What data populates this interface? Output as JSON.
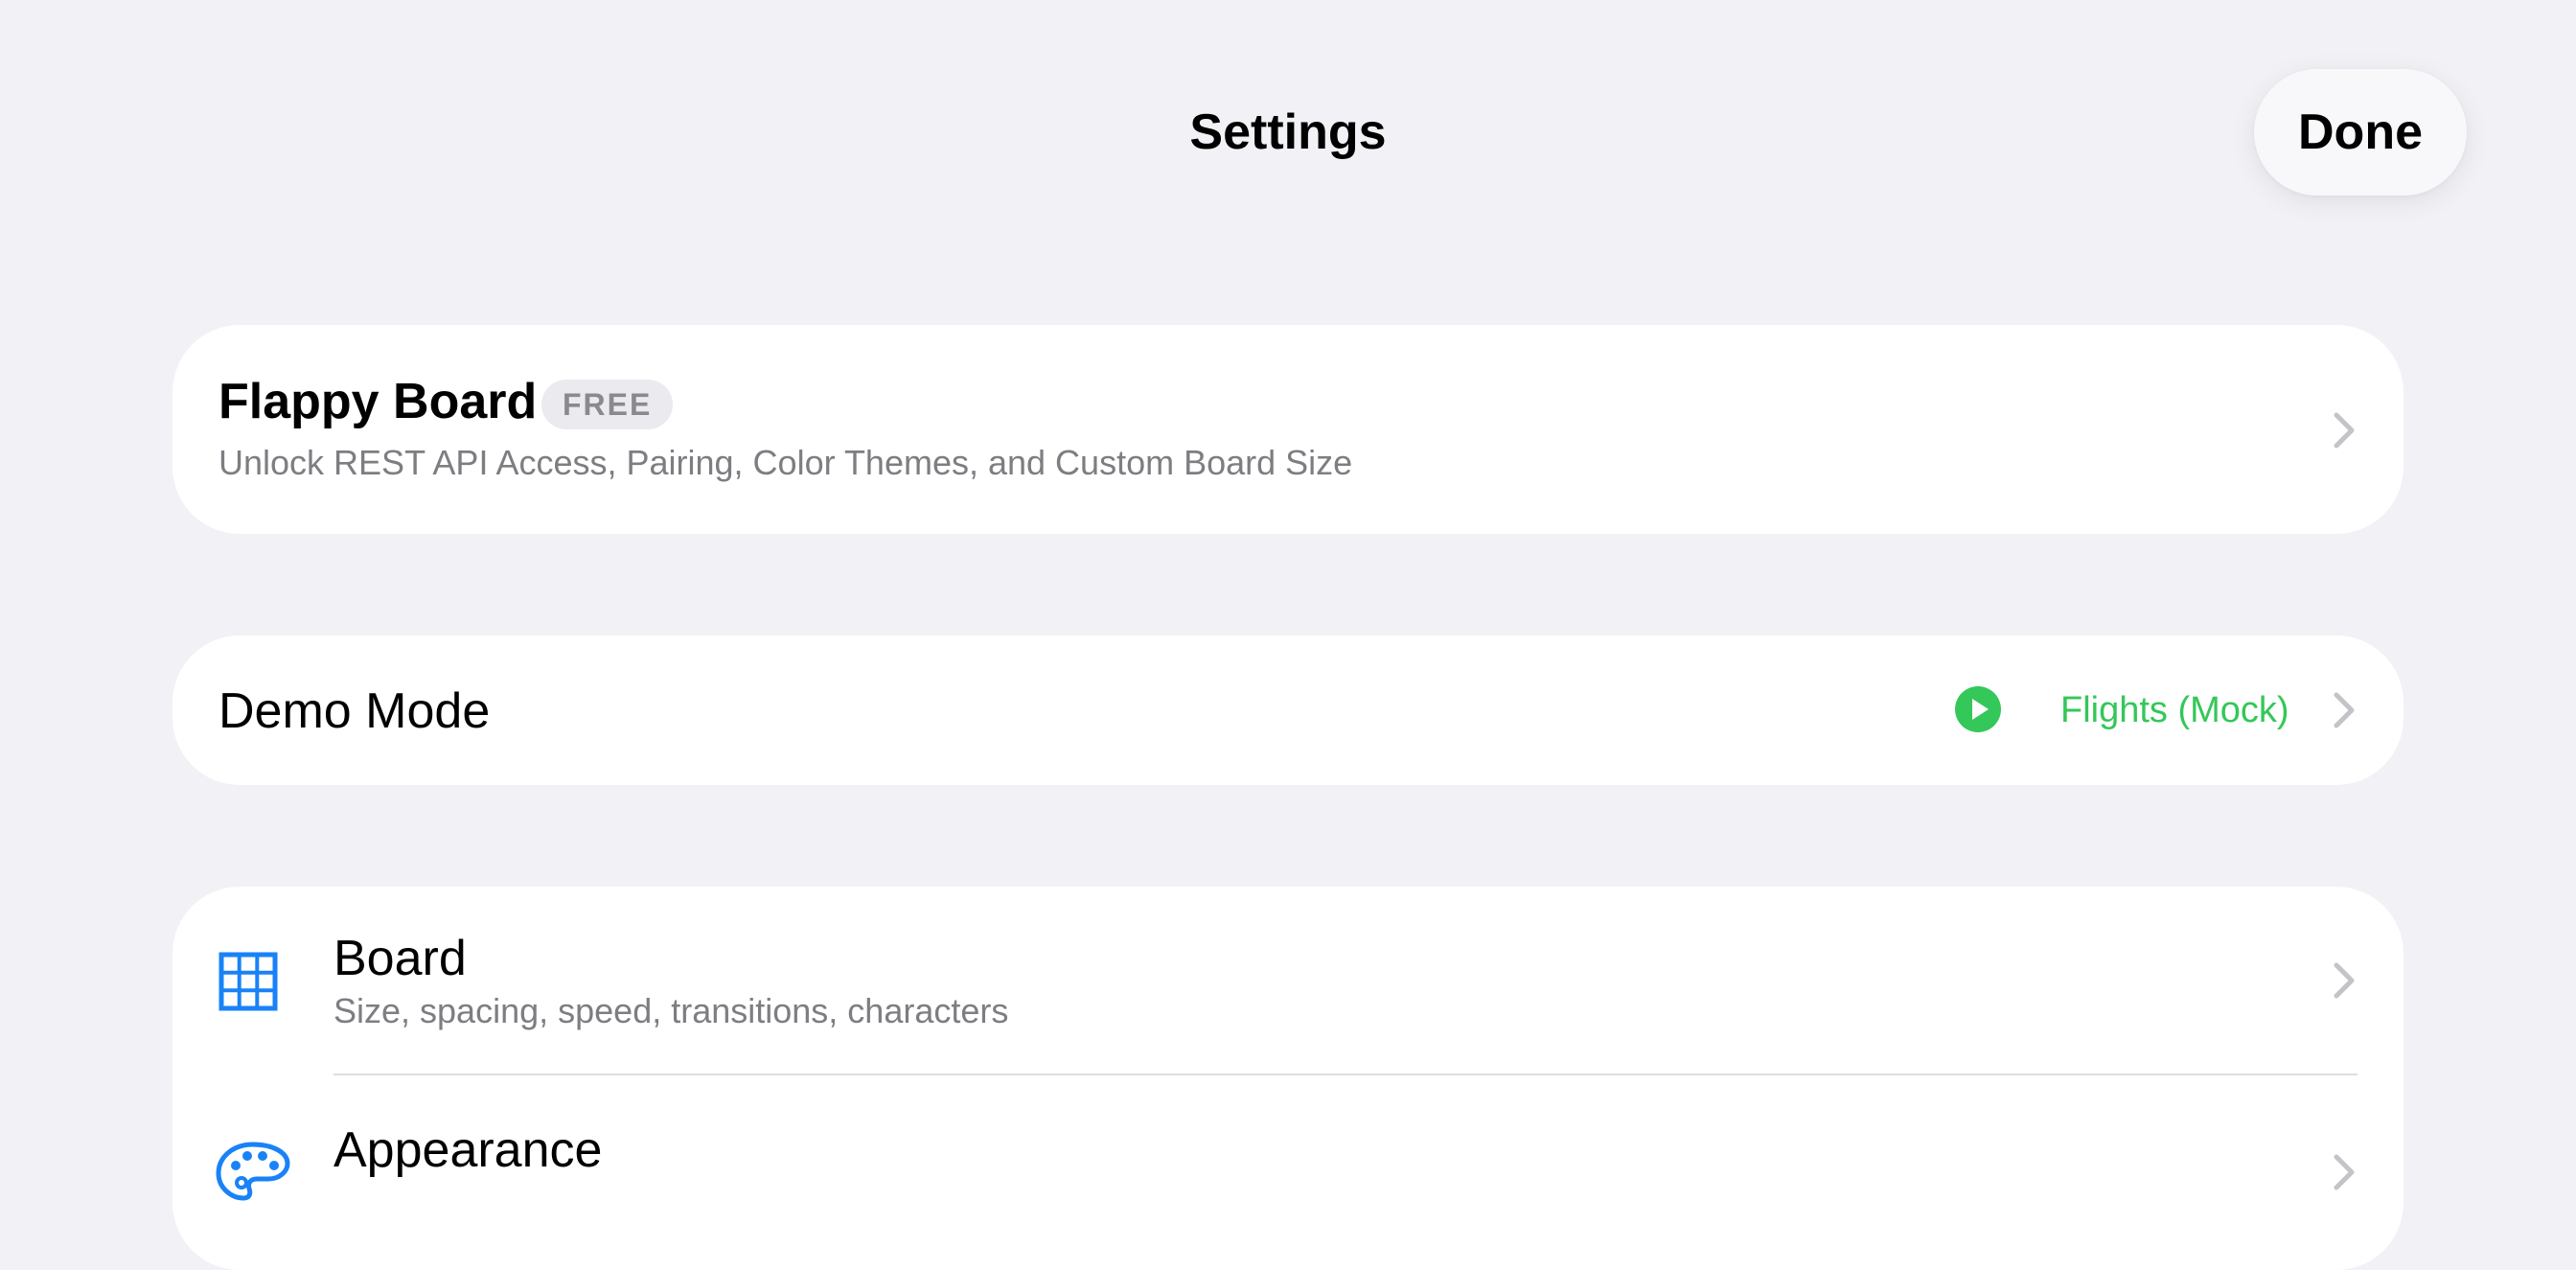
{
  "nav": {
    "title": "Settings",
    "done_label": "Done"
  },
  "pro_card": {
    "title": "Flappy Board",
    "badge": "FREE",
    "subtitle": "Unlock REST API Access, Pairing, Color Themes, and Custom Board Size",
    "chevron_icon": "chevron-right-icon"
  },
  "demo_card": {
    "label": "Demo Mode",
    "status_icon": "play-circle-icon",
    "value": "Flights (Mock)",
    "chevron_icon": "chevron-right-icon"
  },
  "settings_list": {
    "items": [
      {
        "icon": "grid-icon",
        "title": "Board",
        "subtitle": "Size, spacing, speed, transitions, characters"
      },
      {
        "icon": "palette-icon",
        "title": "Appearance"
      }
    ]
  },
  "colors": {
    "background": "#f2f1f6",
    "card": "#ffffff",
    "accent_blue": "#1a82f7",
    "accent_green": "#34c759",
    "secondary_text": "#7d7d82",
    "chevron": "#c4c4c8"
  }
}
